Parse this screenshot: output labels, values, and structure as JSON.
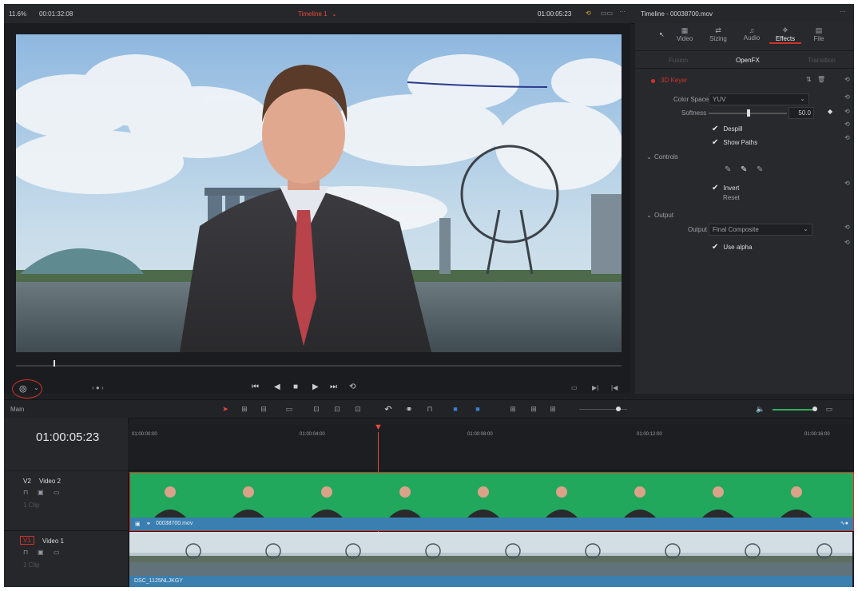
{
  "topbar": {
    "zoom": "11.6%",
    "source_timecode": "00:01:32:08",
    "timeline_name": "Timeline 1",
    "current_timecode": "01:00:05:23",
    "inspector_title": "Timeline - 00038700.mov"
  },
  "inspector": {
    "tabs": [
      {
        "label": "Video",
        "icon": "video-icon"
      },
      {
        "label": "Sizing",
        "icon": "sizing-icon"
      },
      {
        "label": "Audio",
        "icon": "music-note-icon"
      },
      {
        "label": "Effects",
        "icon": "magic-wand-icon",
        "active": true
      },
      {
        "label": "File",
        "icon": "file-icon"
      }
    ],
    "subtabs": [
      "Fusion",
      "OpenFX",
      "Transition"
    ],
    "active_subtab": "OpenFX",
    "effect_name": "3D Keyer",
    "color_space_label": "Color Space",
    "color_space_value": "YUV",
    "softness_label": "Softness",
    "softness_value": "50.0",
    "softness_fraction": 0.5,
    "despill_label": "Despill",
    "show_paths_label": "Show Paths",
    "controls_label": "Controls",
    "invert_label": "Invert",
    "reset_label": "Reset",
    "output_section_label": "Output",
    "output_label": "Output",
    "output_value": "Final Composite",
    "use_alpha_label": "Use alpha"
  },
  "viewer": {
    "accent": "#e64a3c"
  },
  "toolbar": {
    "left_label": "Main"
  },
  "timeline": {
    "timecode": "01:00:05:23",
    "ruler_labels": [
      "01:00:00:00",
      "01:00:04:00",
      "01:00:08:00",
      "01:00:12:00",
      "01:00:16:00"
    ],
    "tracks": [
      {
        "id": "V2",
        "name": "Video 2",
        "clip_count": "1 Clip",
        "clip_name": "00038700.mov",
        "color": "#1fa25a"
      },
      {
        "id": "V1",
        "name": "Video 1",
        "clip_count": "1 Clip",
        "clip_name": "DSC_1125NLJKGY",
        "color": "#3a7fb0"
      }
    ]
  }
}
